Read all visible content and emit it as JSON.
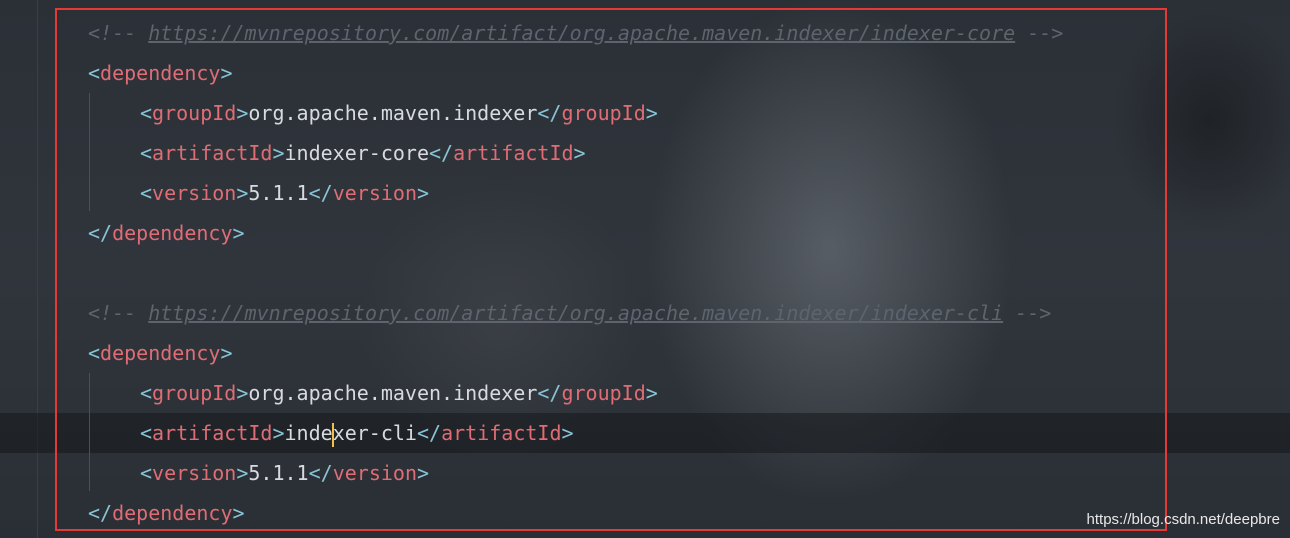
{
  "editor": {
    "lines": [
      {
        "type": "comment",
        "prefix": "<!-- ",
        "url": "https://mvnrepository.com/artifact/org.apache.maven.indexer/indexer-core",
        "suffix": " -->"
      },
      {
        "type": "open",
        "tag": "dependency"
      },
      {
        "type": "element",
        "tag": "groupId",
        "value": "org.apache.maven.indexer"
      },
      {
        "type": "element",
        "tag": "artifactId",
        "value": "indexer-core"
      },
      {
        "type": "element",
        "tag": "version",
        "value": "5.1.1"
      },
      {
        "type": "close",
        "tag": "dependency"
      },
      {
        "type": "comment",
        "prefix": "<!-- ",
        "url": "https://mvnrepository.com/artifact/org.apache.maven.indexer/indexer-cli",
        "suffix": " -->"
      },
      {
        "type": "open",
        "tag": "dependency"
      },
      {
        "type": "element",
        "tag": "groupId",
        "value": "org.apache.maven.indexer"
      },
      {
        "type": "element",
        "tag": "artifactId",
        "value_before_caret": "inde",
        "value_after_caret": "xer-cli"
      },
      {
        "type": "element",
        "tag": "version",
        "value": "5.1.1"
      },
      {
        "type": "close",
        "tag": "dependency"
      }
    ]
  },
  "watermark": "https://blog.csdn.net/deepbre",
  "colors": {
    "highlight_border": "#e53935",
    "tag": "#e06c75",
    "bracket": "#89c4d6",
    "comment": "#5d646e",
    "caret": "#f2c04a"
  }
}
